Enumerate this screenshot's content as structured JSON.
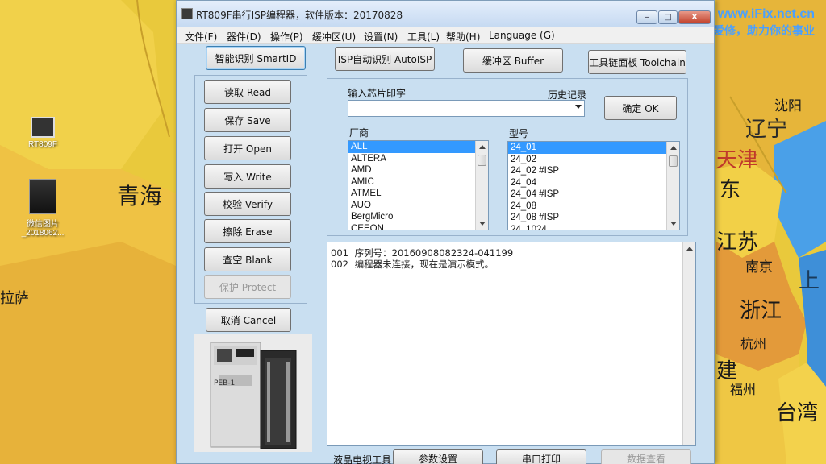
{
  "window": {
    "title": "RT809F串行ISP编程器，软件版本：20170828",
    "controls": [
      "–",
      "□",
      "X"
    ]
  },
  "menu": [
    "文件(F)",
    "器件(D)",
    "操作(P)",
    "缓冲区(U)",
    "设置(N)",
    "工具(L)",
    "帮助(H)",
    "Language (G)"
  ],
  "top_buttons": {
    "smart_id": "智能识别 SmartID",
    "isp_auto": "ISP自动识别 AutoISP",
    "buffer": "缓冲区 Buffer",
    "toolchain": "工具链面板 Toolchain"
  },
  "side_buttons": {
    "read": "读取 Read",
    "save": "保存 Save",
    "open": "打开 Open",
    "write": "写入 Write",
    "verify": "校验 Verify",
    "erase": "擦除 Erase",
    "blank": "查空 Blank",
    "protect": "保护 Protect",
    "cancel": "取消 Cancel"
  },
  "chip_search": {
    "label": "输入芯片印字",
    "history_label": "历史记录",
    "value": "",
    "confirm": "确定 OK"
  },
  "vendor_list": {
    "label": "厂商",
    "items": [
      "ALL",
      "ALTERA",
      "AMD",
      "AMIC",
      "ATMEL",
      "AUO",
      "BergMicro",
      "CEEON"
    ],
    "selected": 0
  },
  "model_list": {
    "label": "型号",
    "items": [
      "24_01",
      "24_02",
      "24_02 #ISP",
      "24_04",
      "24_04 #ISP",
      "24_08",
      "24_08 #ISP",
      "24_1024"
    ],
    "selected": 0
  },
  "log": [
    {
      "num": "001",
      "text": "序列号：20160908082324-041199"
    },
    {
      "num": "002",
      "text": "编程器未连接，现在是演示模式。"
    }
  ],
  "programmer_image": {
    "label": "PEB-1"
  },
  "status_bar": {
    "lcd_tool": "液晶电视工具",
    "params": "参数设置",
    "serial_print": "串口打印",
    "extra": "数据查看"
  },
  "desktop": {
    "icons": [
      {
        "label": "RT809F"
      },
      {
        "label": "微信图片_2018062..."
      }
    ],
    "brand_url": "www.iFix.net.cn",
    "brand_slogan": "爱修，助力你的事业"
  },
  "map_labels": {
    "qinghai": "青海",
    "lasa": "拉萨",
    "liaoning": "辽宁",
    "shenyang": "沈阳",
    "tianjin": "天津",
    "dong": "东",
    "jiangsu": "江苏",
    "nanjing": "南京",
    "shang": "上",
    "zhejiang": "浙江",
    "hangzhou": "杭州",
    "jian": "建",
    "fuzhou": "福州",
    "taiwan": "台湾"
  }
}
